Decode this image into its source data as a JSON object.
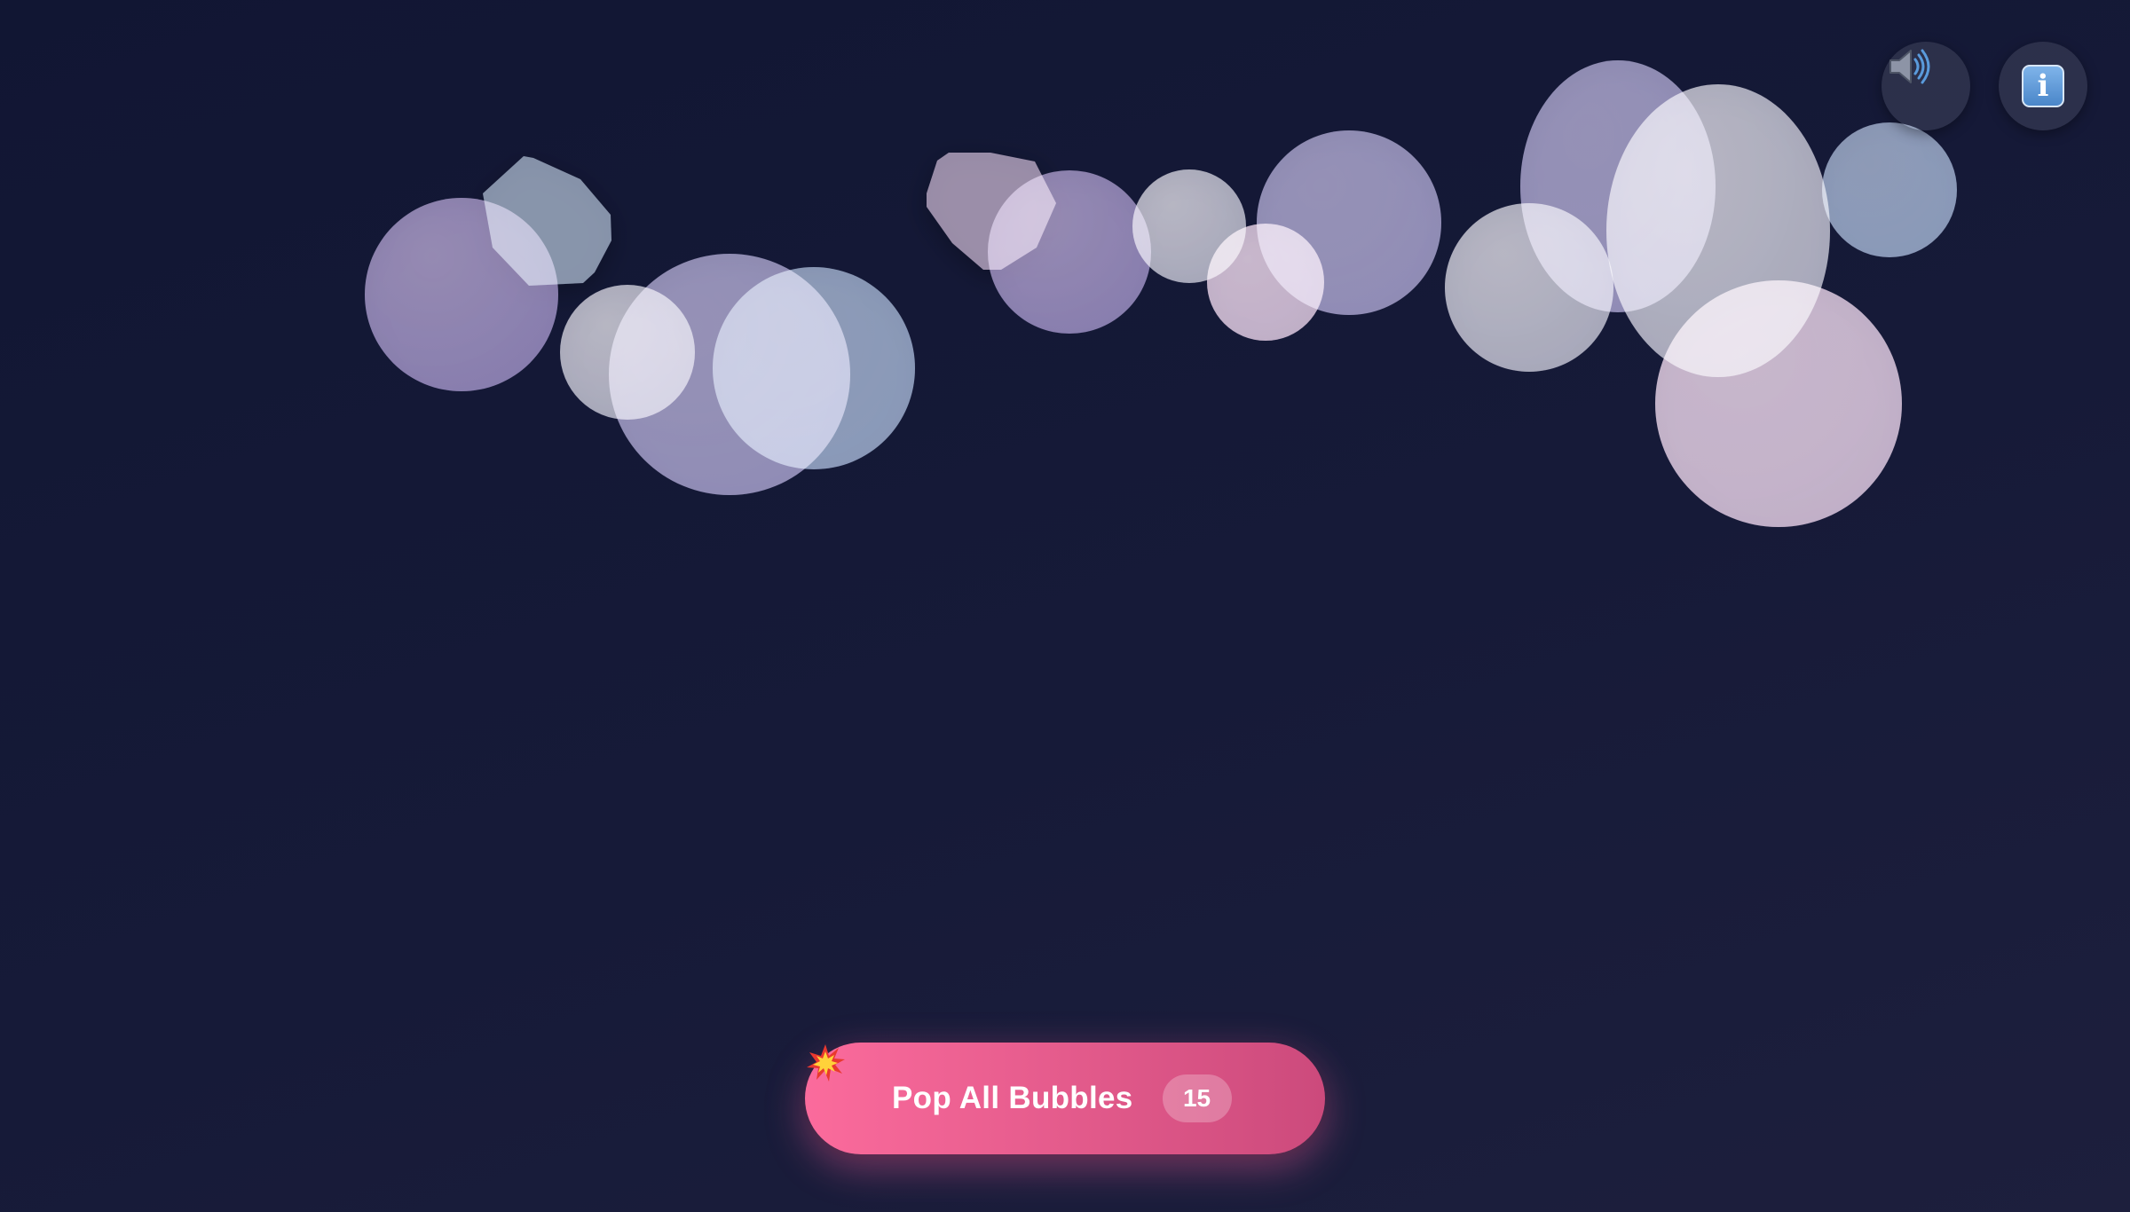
{
  "controls": {
    "sound_icon": "speaker-icon",
    "info_icon": "info-icon",
    "info_glyph": "i"
  },
  "action_button": {
    "icon": "collision-burst-icon",
    "label": "Pop All Bubbles",
    "count": "15"
  },
  "colors": {
    "background": "#141833",
    "button_gradient_start": "#fb6b9c",
    "button_gradient_end": "#cc4a7c",
    "bubble_tints": [
      "#a996c2",
      "#c8c8d0",
      "#b0aed2",
      "#b3c2d6",
      "#e0c6d8"
    ]
  },
  "bubbles": {
    "count_visible": 15,
    "popping_fragments": 2
  }
}
